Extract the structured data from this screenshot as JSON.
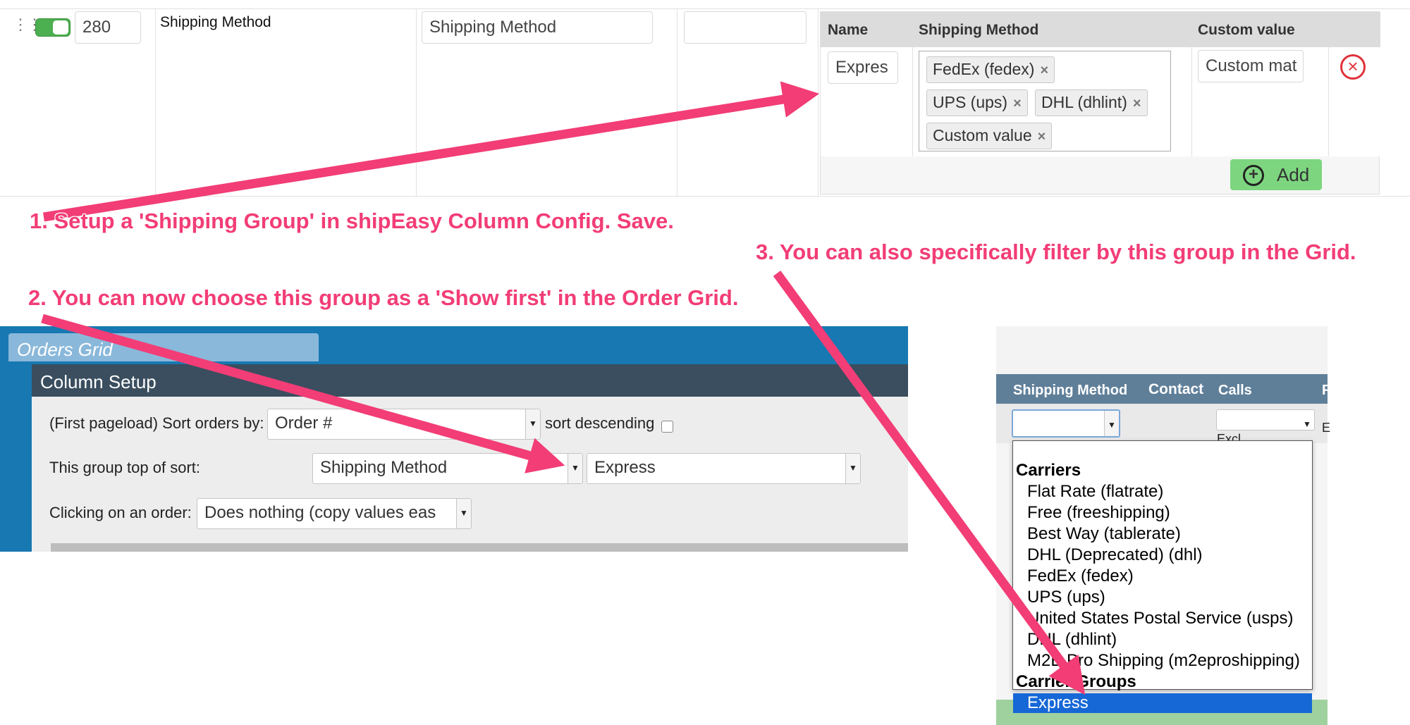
{
  "config_row": {
    "sort_value": "280",
    "column_label": "Shipping Method",
    "title_input": "Shipping Method",
    "extra_input": "",
    "table": {
      "headers": [
        "Name",
        "Shipping Method",
        "Custom value"
      ],
      "name_value": "Expres",
      "methods": [
        "FedEx (fedex)",
        "UPS (ups)",
        "DHL (dhlint)",
        "Custom value"
      ],
      "remove_glyph": "×",
      "custom_value": "Custom mat",
      "add_label": "Add"
    }
  },
  "annotations": {
    "step1": "1. Setup a 'Shipping Group' in shipEasy Column Config. Save.",
    "step2": "2. You can now choose this group as a 'Show first' in the Order Grid.",
    "step3": "3. You can also specifically filter by this group in the Grid.",
    "color": "#f23d76"
  },
  "orders_grid": {
    "tab": "Orders Grid",
    "section": "Column Setup",
    "sort_label": "(First pageload) Sort orders by:",
    "sort_value": "Order #",
    "sort_desc_label": "sort descending",
    "top_label": "This group top of sort:",
    "top_field": "Shipping Method",
    "top_value": "Express",
    "click_label": "Clicking on an order:",
    "click_value": "Does nothing (copy values eas"
  },
  "filter_grid": {
    "columns": [
      "Shipping Method",
      "Contact",
      "Calls",
      "F"
    ],
    "excl_label": "Excl",
    "e_label": "E",
    "groups": [
      {
        "label": "Carriers",
        "options": [
          "Flat Rate (flatrate)",
          "Free (freeshipping)",
          "Best Way (tablerate)",
          "DHL (Deprecated) (dhl)",
          "FedEx (fedex)",
          "UPS (ups)",
          "United States Postal Service (usps)",
          "DHL (dhlint)",
          "M2E Pro Shipping (m2eproshipping)"
        ]
      },
      {
        "label": "Carrier Groups",
        "options": [
          "Express"
        ]
      }
    ],
    "selected": "Express"
  },
  "icons": {
    "grip": "grip-icon",
    "toggle": "toggle-icon",
    "remove": "remove-circle-icon",
    "add": "plus-circle-icon",
    "arrow": "dropdown-arrow-icon"
  }
}
